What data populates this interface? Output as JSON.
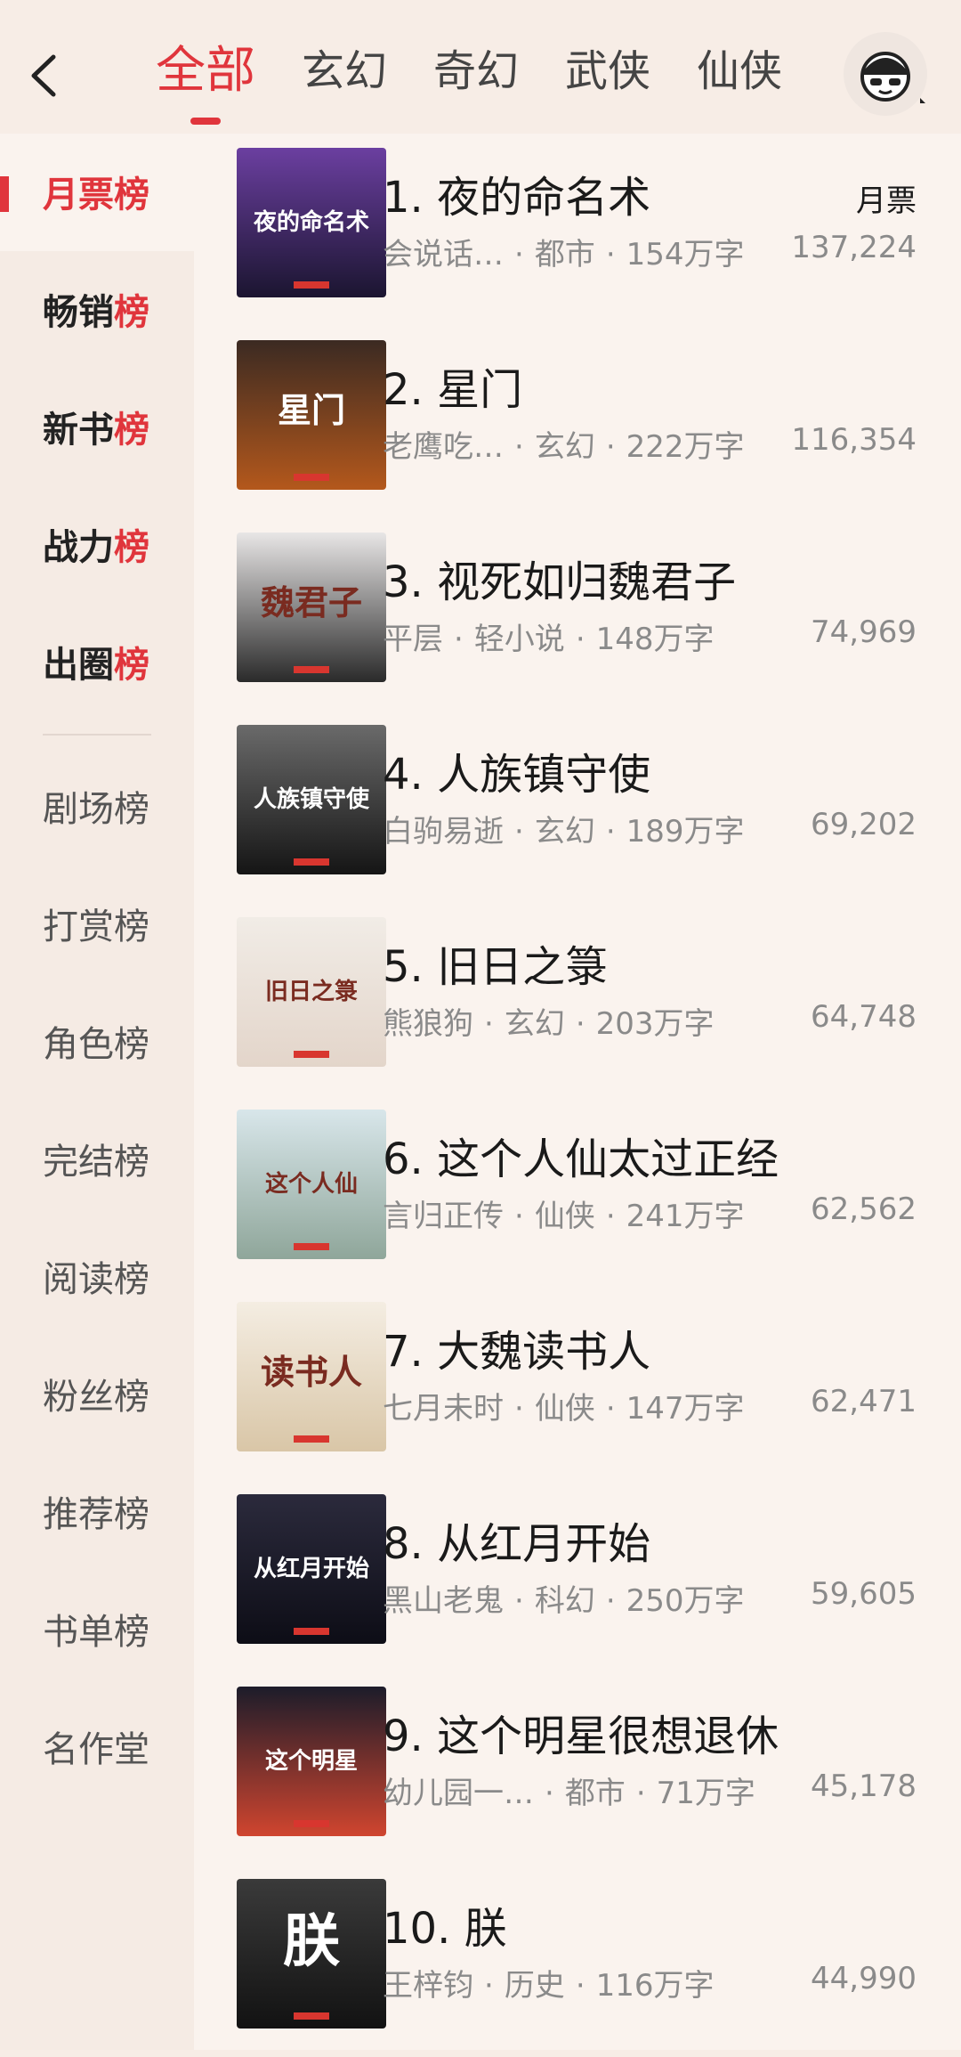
{
  "header": {
    "tabs": [
      "全部",
      "玄幻",
      "奇幻",
      "武侠",
      "仙侠"
    ],
    "active_tab": 0
  },
  "sidebar": {
    "items": [
      {
        "label_main": "月票",
        "label_hl": "榜",
        "kind": "active"
      },
      {
        "label_main": "畅销",
        "label_hl": "榜",
        "kind": "hot"
      },
      {
        "label_main": "新书",
        "label_hl": "榜",
        "kind": "hot"
      },
      {
        "label_main": "战力",
        "label_hl": "榜",
        "kind": "hot"
      },
      {
        "label_main": "出圈",
        "label_hl": "榜",
        "kind": "hot"
      },
      {
        "label_main": "剧场榜",
        "label_hl": "",
        "kind": "plain"
      },
      {
        "label_main": "打赏榜",
        "label_hl": "",
        "kind": "plain"
      },
      {
        "label_main": "角色榜",
        "label_hl": "",
        "kind": "plain"
      },
      {
        "label_main": "完结榜",
        "label_hl": "",
        "kind": "plain"
      },
      {
        "label_main": "阅读榜",
        "label_hl": "",
        "kind": "plain"
      },
      {
        "label_main": "粉丝榜",
        "label_hl": "",
        "kind": "plain"
      },
      {
        "label_main": "推荐榜",
        "label_hl": "",
        "kind": "plain"
      },
      {
        "label_main": "书单榜",
        "label_hl": "",
        "kind": "plain"
      },
      {
        "label_main": "名作堂",
        "label_hl": "",
        "kind": "plain"
      }
    ]
  },
  "list": {
    "metric_label": "月票",
    "books": [
      {
        "rank": "1.",
        "title": "夜的命名术",
        "author": "会说话…",
        "category": "都市",
        "words": "154万字",
        "votes": "137,224",
        "cover_top": "#6b3fa0",
        "cover_bottom": "#1b1530",
        "cover_text": "夜的命名术"
      },
      {
        "rank": "2.",
        "title": "星门",
        "author": "老鹰吃…",
        "category": "玄幻",
        "words": "222万字",
        "votes": "116,354",
        "cover_top": "#3b2a22",
        "cover_bottom": "#b4581c",
        "cover_text": "星门"
      },
      {
        "rank": "3.",
        "title": "视死如归魏君子",
        "author": "平层",
        "category": "轻小说",
        "words": "148万字",
        "votes": "74,969",
        "cover_top": "#e8e6e6",
        "cover_bottom": "#2a2a2a",
        "cover_text": "魏君子"
      },
      {
        "rank": "4.",
        "title": "人族镇守使",
        "author": "白驹易逝",
        "category": "玄幻",
        "words": "189万字",
        "votes": "69,202",
        "cover_top": "#6a6a6a",
        "cover_bottom": "#151515",
        "cover_text": "人族镇守使"
      },
      {
        "rank": "5.",
        "title": "旧日之箓",
        "author": "熊狼狗",
        "category": "玄幻",
        "words": "203万字",
        "votes": "64,748",
        "cover_top": "#f1ece6",
        "cover_bottom": "#e3d5ca",
        "cover_text": "旧日之箓"
      },
      {
        "rank": "6.",
        "title": "这个人仙太过正经",
        "author": "言归正传",
        "category": "仙侠",
        "words": "241万字",
        "votes": "62,562",
        "cover_top": "#d8e6ea",
        "cover_bottom": "#8fa69a",
        "cover_text": "这个人仙"
      },
      {
        "rank": "7.",
        "title": "大魏读书人",
        "author": "七月未时",
        "category": "仙侠",
        "words": "147万字",
        "votes": "62,471",
        "cover_top": "#f4ede2",
        "cover_bottom": "#d9c6a7",
        "cover_text": "读书人"
      },
      {
        "rank": "8.",
        "title": "从红月开始",
        "author": "黑山老鬼",
        "category": "科幻",
        "words": "250万字",
        "votes": "59,605",
        "cover_top": "#2b2a3c",
        "cover_bottom": "#0d0d16",
        "cover_text": "从红月开始"
      },
      {
        "rank": "9.",
        "title": "这个明星很想退休",
        "author": "幼儿园一…",
        "category": "都市",
        "words": "71万字",
        "votes": "45,178",
        "cover_top": "#1c1c2a",
        "cover_bottom": "#d0452f",
        "cover_text": "这个明星"
      },
      {
        "rank": "10.",
        "title": "朕",
        "author": "王梓钧",
        "category": "历史",
        "words": "116万字",
        "votes": "44,990",
        "cover_top": "#3a3a3a",
        "cover_bottom": "#121212",
        "cover_text": "朕"
      }
    ]
  }
}
